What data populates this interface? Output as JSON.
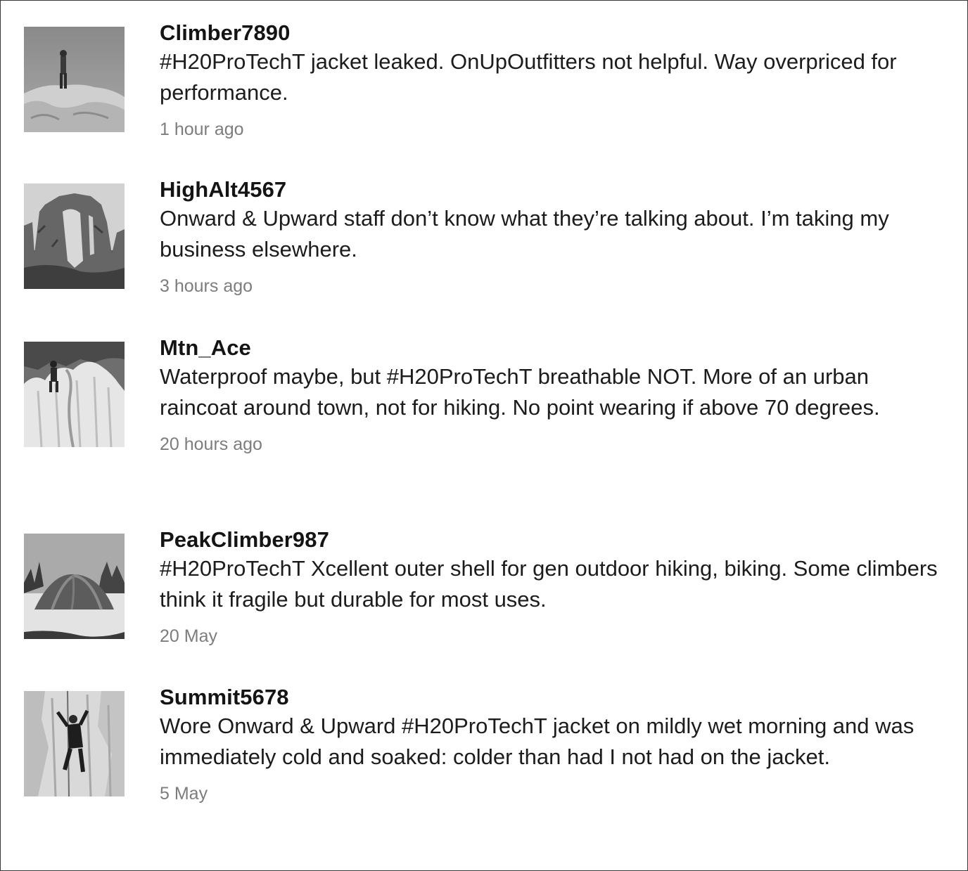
{
  "feed": {
    "posts": [
      {
        "username": "Climber7890",
        "text": "#H20ProTechT jacket leaked. OnUpOutfitters not helpful. Way overpriced for performance.",
        "time": "1 hour ago",
        "avatar_icon": "climber-on-rock-summit-photo"
      },
      {
        "username": "HighAlt4567",
        "text": "Onward & Upward staff don’t know what they’re talking about. I’m taking my business elsewhere.",
        "time": "3 hours ago",
        "avatar_icon": "rock-arch-photo"
      },
      {
        "username": "Mtn_Ace",
        "text": "Waterproof maybe, but #H20ProTechT breathable NOT. More of an urban raincoat around town, not for hiking. No point wearing if above 70 degrees.",
        "time": "20 hours ago",
        "avatar_icon": "ice-climber-photo"
      },
      {
        "username": "PeakClimber987",
        "text": "#H20ProTechT Xcellent outer shell for gen outdoor hiking, biking. Some climbers think it fragile but durable for most uses.",
        "time": "20 May",
        "avatar_icon": "tent-in-snow-photo"
      },
      {
        "username": "Summit5678",
        "text": "Wore Onward & Upward #H20ProTechT jacket on mildly wet morning and was immediately cold and soaked: colder than had I not had on the jacket.",
        "time": "5 May",
        "avatar_icon": "ice-wall-climber-photo"
      }
    ]
  }
}
